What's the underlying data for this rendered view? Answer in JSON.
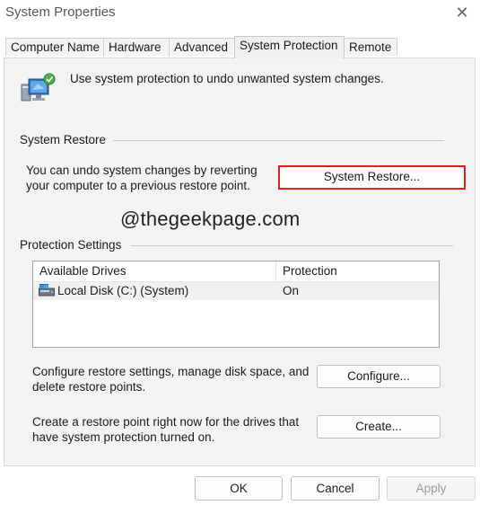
{
  "window": {
    "title": "System Properties",
    "close_glyph": "✕"
  },
  "tabs": [
    {
      "label": "Computer Name",
      "active": false
    },
    {
      "label": "Hardware",
      "active": false
    },
    {
      "label": "Advanced",
      "active": false
    },
    {
      "label": "System Protection",
      "active": true
    },
    {
      "label": "Remote",
      "active": false
    }
  ],
  "intro": {
    "icon": "system-protection-icon",
    "text": "Use system protection to undo unwanted system changes."
  },
  "system_restore": {
    "group_label": "System Restore",
    "description_line1": "You can undo system changes by reverting",
    "description_line2": "your computer to a previous restore point.",
    "button_label": "System Restore..."
  },
  "watermark": "@thegeekpage.com",
  "protection_settings": {
    "group_label": "Protection Settings",
    "columns": [
      "Available Drives",
      "Protection"
    ],
    "rows": [
      {
        "drive": "Local Disk (C:) (System)",
        "protection": "On",
        "icon": "drive-icon"
      }
    ],
    "configure_text_line1": "Configure restore settings, manage disk space, and",
    "configure_text_line2": "delete restore points.",
    "configure_button": "Configure...",
    "create_text_line1": "Create a restore point right now for the drives that",
    "create_text_line2": "have system protection turned on.",
    "create_button": "Create..."
  },
  "dialog_buttons": {
    "ok": "OK",
    "cancel": "Cancel",
    "apply": "Apply"
  },
  "colors": {
    "highlight_border": "#e02020",
    "panel_bg": "#f3f3f3"
  }
}
